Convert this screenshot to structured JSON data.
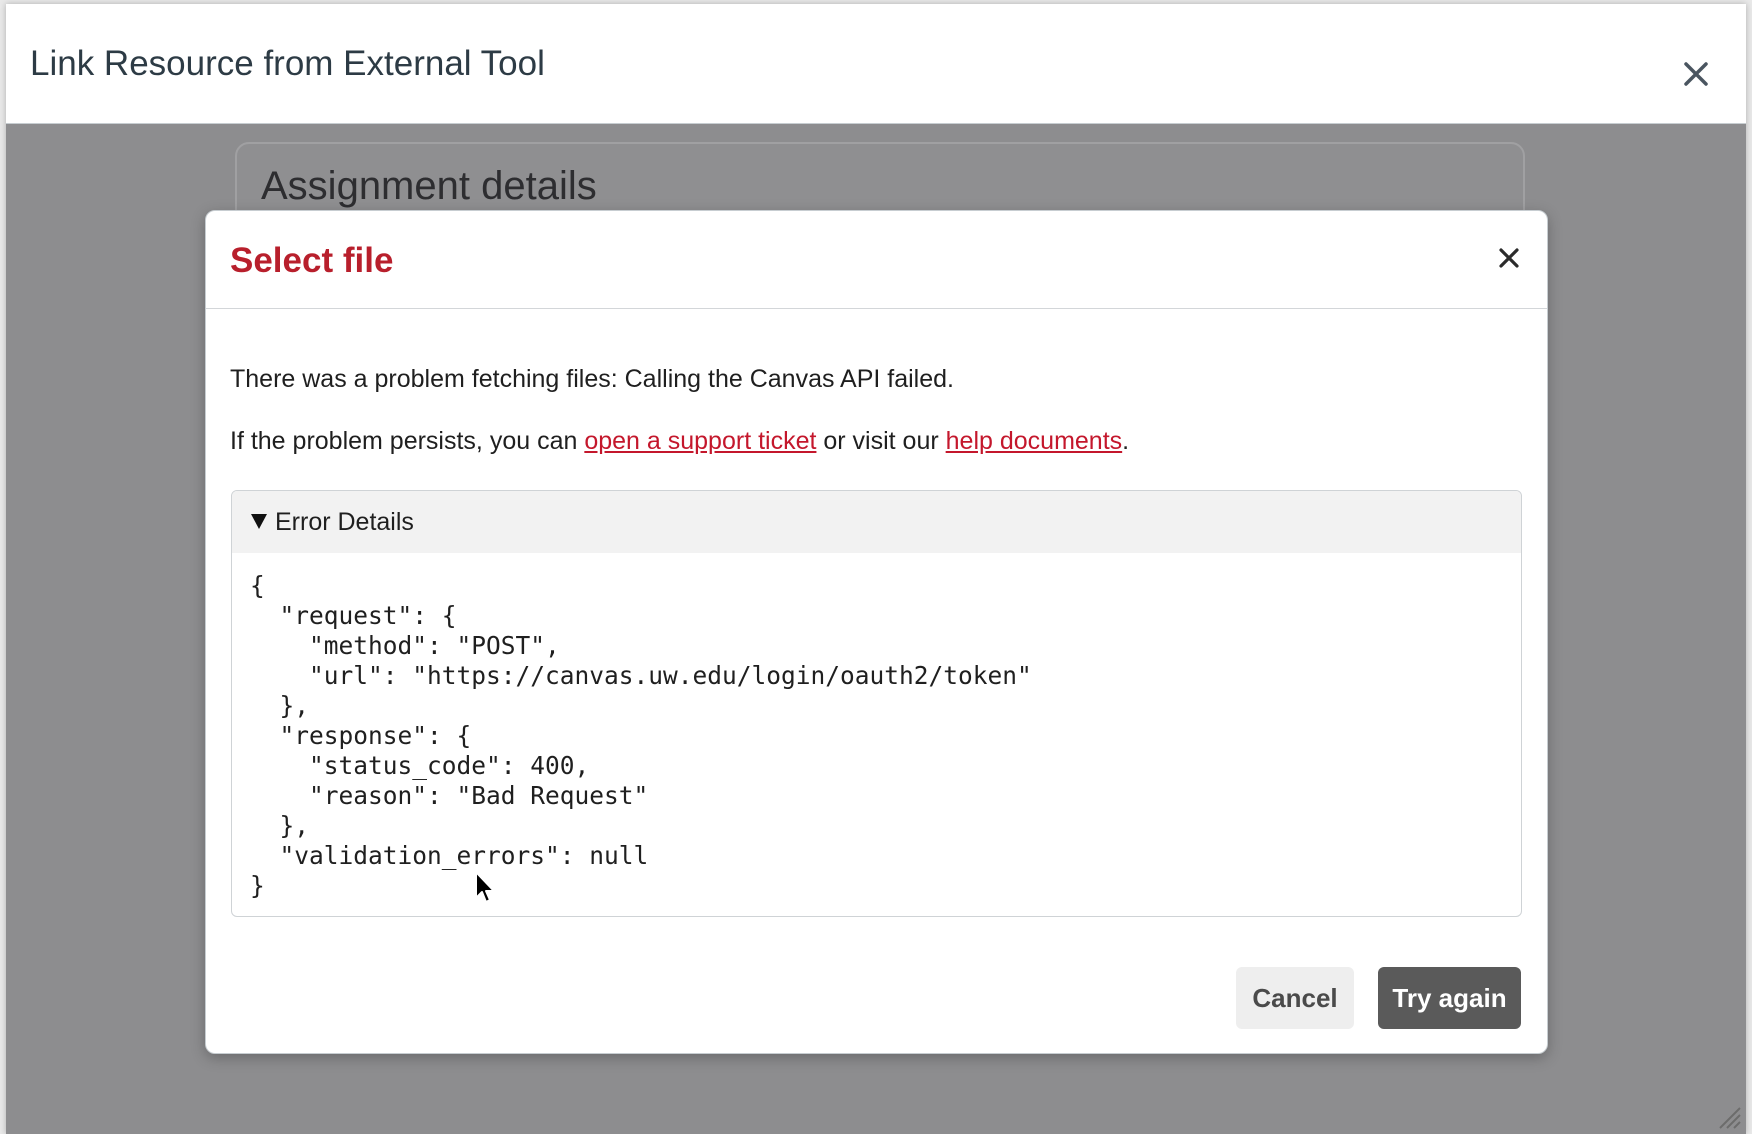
{
  "outer_modal": {
    "title": "Link Resource from External Tool",
    "close_icon": "close-icon"
  },
  "background": {
    "card_title": "Assignment details"
  },
  "dialog": {
    "title": "Select file",
    "close_icon": "close-icon",
    "message": "There was a problem fetching files: Calling the Canvas API failed.",
    "persist_prefix": "If the problem persists, you can ",
    "support_link": "open a support ticket",
    "persist_middle": " or visit our ",
    "help_link": "help documents",
    "persist_suffix": ".",
    "details": {
      "summary": "Error Details",
      "expanded": true,
      "code": "{\n  \"request\": {\n    \"method\": \"POST\",\n    \"url\": \"https://canvas.uw.edu/login/oauth2/token\"\n  },\n  \"response\": {\n    \"status_code\": 400,\n    \"reason\": \"Bad Request\"\n  },\n  \"validation_errors\": null\n}"
    },
    "buttons": {
      "cancel": "Cancel",
      "try_again": "Try again"
    }
  },
  "colors": {
    "title_red": "#b81f2c",
    "link_red": "#c4172c",
    "overlay_gray": "#8d8d8f",
    "primary_button": "#5a5a5a"
  }
}
